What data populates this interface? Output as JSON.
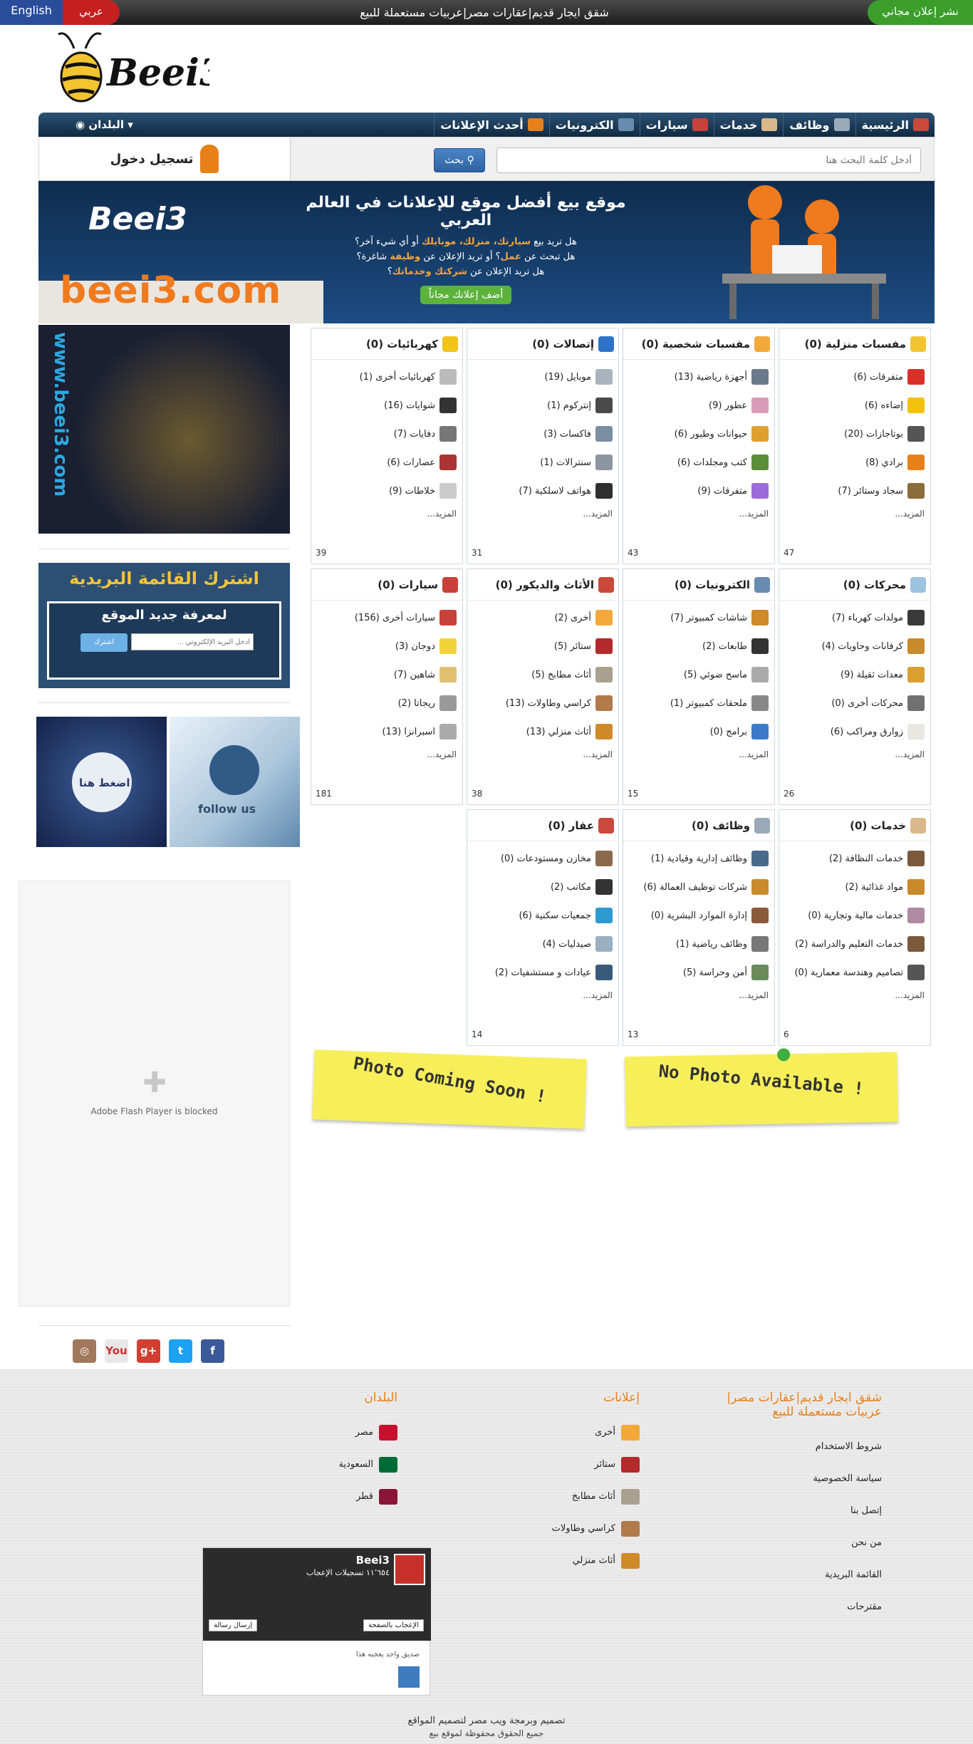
{
  "topbar": {
    "english": "English",
    "arabic": "عربي",
    "ticker": "شقق ايجار قديم|عقارات مصر|عربيات مستعملة للبيع",
    "post_free": "نشر إعلان مجاني"
  },
  "logo": {
    "text": "Beei3"
  },
  "nav": {
    "items": [
      {
        "label": "الرئيسية",
        "icon": "home-icon",
        "color": "#c94a3a"
      },
      {
        "label": "وظائف",
        "icon": "jobs-icon",
        "color": "#9aa9b8"
      },
      {
        "label": "خدمات",
        "icon": "handshake-icon",
        "color": "#d9b98a"
      },
      {
        "label": "سيارات",
        "icon": "car-icon",
        "color": "#c8413a"
      },
      {
        "label": "الكترونيات",
        "icon": "computer-icon",
        "color": "#6a8bb0"
      },
      {
        "label": "أحدث الإعلانات",
        "icon": "new-badge-icon",
        "color": "#e8801a"
      }
    ],
    "countries": "البلدان"
  },
  "search": {
    "placeholder": "أدخل كلمة البحث هنا",
    "button": "بحث"
  },
  "login": {
    "label": "تسجيل دخول"
  },
  "banner": {
    "title": "موقع بيع أفضل موقع للإعلانات في العالم العربي",
    "line1_pre": "هل تريد بيع",
    "line1_hl": "سيارتك، منزلك، موبايلك",
    "line1_post": "أو أي شيء آخر؟",
    "line2_pre": "هل تبحث عن",
    "line2_hl1": "عمل",
    "line2_mid": "؟ أو تريد الإعلان عن",
    "line2_hl2": "وظيفة",
    "line2_post": "شاغرة؟",
    "line3_pre": "هل تريد الإعلان عن",
    "line3_hl": "شركتك وخدماتك",
    "line3_post": "؟",
    "button": "أضف إعلانك مجاناً",
    "domain": "beei3.com",
    "logo": "Beei3"
  },
  "sidebar": {
    "ad1_text": "www.beei3.com",
    "newsletter_title": "اشترك القائمة البريدية",
    "newsletter_sub": "لمعرفة جديد الموقع",
    "newsletter_placeholder": "أدخل البريد الإلكتروني ...",
    "newsletter_button": "اشترك",
    "twitter_follow": "follow us",
    "twitter_click": "اضغط هنا",
    "flash_text": "Adobe Flash Player is blocked",
    "social": [
      {
        "icon": "facebook-icon",
        "glyph": "f",
        "color": "#3b5998"
      },
      {
        "icon": "twitter-icon",
        "glyph": "t",
        "color": "#1da1f2"
      },
      {
        "icon": "googleplus-icon",
        "glyph": "g+",
        "color": "#d23f31"
      },
      {
        "icon": "youtube-icon",
        "glyph": "You",
        "color": "#e8e8e8"
      },
      {
        "icon": "instagram-icon",
        "glyph": "◎",
        "color": "#a1785c"
      }
    ]
  },
  "categories": [
    {
      "title": "مفسبات منزلية (0)",
      "icon": "star-icon",
      "color": "#f2c530",
      "count": "47",
      "items": [
        {
          "label": "متفرقات (6)",
          "color": "#d9302a"
        },
        {
          "label": "إضاءه (6)",
          "color": "#f4c20d"
        },
        {
          "label": "بوتاجازات (20)",
          "color": "#555"
        },
        {
          "label": "برادي (8)",
          "color": "#e8801a"
        },
        {
          "label": "سجاد وستائر (7)",
          "color": "#8a6d3b"
        }
      ]
    },
    {
      "title": "مفسبات شخصية (0)",
      "icon": "m-icon",
      "color": "#f2a93a",
      "count": "43",
      "items": [
        {
          "label": "أجهزة رياضية (13)",
          "color": "#6a7a8a"
        },
        {
          "label": "عطور (9)",
          "color": "#d99bb5"
        },
        {
          "label": "حيوانات وطيور (6)",
          "color": "#e0a030"
        },
        {
          "label": "كتب ومجلدات (6)",
          "color": "#5b8c3a"
        },
        {
          "label": "متفرقات (9)",
          "color": "#9b6cd8"
        }
      ]
    },
    {
      "title": "إتصالات (0)",
      "icon": "phone-icon",
      "color": "#2e73c9",
      "count": "31",
      "items": [
        {
          "label": "موبايل (19)",
          "color": "#aab4be"
        },
        {
          "label": "إنتركوم (1)",
          "color": "#4a4a4a"
        },
        {
          "label": "فاكسات (3)",
          "color": "#7a8ea4"
        },
        {
          "label": "سنترالات (1)",
          "color": "#8d96a0"
        },
        {
          "label": "هواتف لاسلكية (7)",
          "color": "#2f2f2f"
        }
      ]
    },
    {
      "title": "كهربائيات (0)",
      "icon": "warning-icon",
      "color": "#f0c419",
      "count": "39",
      "items": [
        {
          "label": "كهربائيات أخرى (1)",
          "color": "#bbb"
        },
        {
          "label": "شوايات (16)",
          "color": "#333"
        },
        {
          "label": "دفايات (7)",
          "color": "#777"
        },
        {
          "label": "عصارات (6)",
          "color": "#a33"
        },
        {
          "label": "خلاطات (9)",
          "color": "#ccc"
        }
      ]
    },
    {
      "title": "محركات (0)",
      "icon": "gear-icon",
      "color": "#9cc3e0",
      "count": "26",
      "items": [
        {
          "label": "مولدات كهرباء (7)",
          "color": "#3a3a3a"
        },
        {
          "label": "كرفانات وحاويات (4)",
          "color": "#c98a2b"
        },
        {
          "label": "معدات ثقيلة (9)",
          "color": "#d9a030"
        },
        {
          "label": "محركات أخرى (0)",
          "color": "#707070"
        },
        {
          "label": "زوارق ومراكب (6)",
          "color": "#e8e8e0"
        }
      ]
    },
    {
      "title": "الكترونيات (0)",
      "icon": "computer-icon",
      "color": "#6a8bb0",
      "count": "15",
      "items": [
        {
          "label": "شاشات كمبيوتر (7)",
          "color": "#d08a2a"
        },
        {
          "label": "طابعات (2)",
          "color": "#333"
        },
        {
          "label": "ماسح ضوئي (5)",
          "color": "#aaa"
        },
        {
          "label": "ملحقات كمبيوتر (1)",
          "color": "#888"
        },
        {
          "label": "برامج (0)",
          "color": "#3a7ac9"
        }
      ]
    },
    {
      "title": "الأثاث والديكور (0)",
      "icon": "house-icon",
      "color": "#c94a3a",
      "count": "38",
      "items": [
        {
          "label": "أخرى (2)",
          "color": "#f2a93a"
        },
        {
          "label": "ستائر (5)",
          "color": "#b22a2a"
        },
        {
          "label": "أثاث مطابخ (5)",
          "color": "#a9a090"
        },
        {
          "label": "كراسي وطاولات (13)",
          "color": "#b07a4a"
        },
        {
          "label": "أثاث منزلي (13)",
          "color": "#d08a2a"
        }
      ]
    },
    {
      "title": "سيارات (0)",
      "icon": "car-icon",
      "color": "#c8413a",
      "count": "181",
      "items": [
        {
          "label": "سيارات أخرى (156)",
          "color": "#c8413a"
        },
        {
          "label": "دوجان (3)",
          "color": "#f2d23a"
        },
        {
          "label": "شاهين (7)",
          "color": "#e0c070"
        },
        {
          "label": "ريجاتا (2)",
          "color": "#999"
        },
        {
          "label": "اسبرانزا (13)",
          "color": "#aaa"
        }
      ]
    },
    {
      "title": "خدمات (0)",
      "icon": "handshake-icon",
      "color": "#d9b98a",
      "count": "6",
      "items": [
        {
          "label": "خدمات النظافة (2)",
          "color": "#7a5a3a"
        },
        {
          "label": "مواد غذائية (2)",
          "color": "#c98a2b"
        },
        {
          "label": "خدمات مالية وتجارية (0)",
          "color": "#b08aa0"
        },
        {
          "label": "خدمات التعليم والدراسة (2)",
          "color": "#7a5a3a"
        },
        {
          "label": "تصاميم وهندسة معمارية (0)",
          "color": "#555"
        }
      ]
    },
    {
      "title": "وظائف (0)",
      "icon": "jobs-icon",
      "color": "#9aa9b8",
      "count": "13",
      "items": [
        {
          "label": "وظائف إدارية وقيادية (1)",
          "color": "#4a6a8a"
        },
        {
          "label": "شركات توظيف العمالة (6)",
          "color": "#c98a2b"
        },
        {
          "label": "إدارة الموارد البشرية (0)",
          "color": "#8a5a3a"
        },
        {
          "label": "وظائف رياضية (1)",
          "color": "#777"
        },
        {
          "label": "أمن وحراسة (5)",
          "color": "#6a8a5a"
        }
      ]
    },
    {
      "title": "عقار (0)",
      "icon": "house-icon",
      "color": "#c94a3a",
      "count": "14",
      "items": [
        {
          "label": "مخازن ومستودعات (0)",
          "color": "#8a6a4a"
        },
        {
          "label": "مكاتب (2)",
          "color": "#333"
        },
        {
          "label": "جمعيات سكنية (6)",
          "color": "#2e9ad0"
        },
        {
          "label": "صيدليات (4)",
          "color": "#9ab0c0"
        },
        {
          "label": "عيادات و مستشفيات (2)",
          "color": "#3a5a7a"
        }
      ]
    }
  ],
  "more_label": "المزيد...",
  "notes": {
    "left": "Photo Coming Soon !",
    "right": "No Photo Available !"
  },
  "footer": {
    "col1_title": "شقق ايجار قديم|عقارات مصر|عربيات مستعملة للبيع",
    "col1_links": [
      "شروط الاستخدام",
      "سياسة الخصوصية",
      "إتصل بنا",
      "من نحن",
      "القائمة البريدية",
      "مقترحات"
    ],
    "col2_title": "إعلانات",
    "col2_links": [
      {
        "label": "أخرى",
        "color": "#f2a93a"
      },
      {
        "label": "ستائر",
        "color": "#b22a2a"
      },
      {
        "label": "أثاث مطابخ",
        "color": "#a9a090"
      },
      {
        "label": "كراسي وطاولات",
        "color": "#b07a4a"
      },
      {
        "label": "أثاث منزلي",
        "color": "#d08a2a"
      }
    ],
    "col3_title": "البلدان",
    "col3_links": [
      {
        "label": "مصر",
        "color": "#c8102e"
      },
      {
        "label": "السعودية",
        "color": "#006c35"
      },
      {
        "label": "قطر",
        "color": "#8a1538"
      }
    ],
    "fb_name": "Beei3",
    "fb_likes": "١١٬٦٥٤ تسجيلات الإعجاب",
    "fb_like_btn": "الإعجاب بالصفحة",
    "fb_msg_btn": "إرسال رسالة",
    "fb_friend": "صديق واحد يعجبه هذا",
    "credit1": "تصميم وبرمجة ويب مصر لتصميم المواقع",
    "credit2": "جميع الحقوق محفوظة لموقع بيع"
  }
}
